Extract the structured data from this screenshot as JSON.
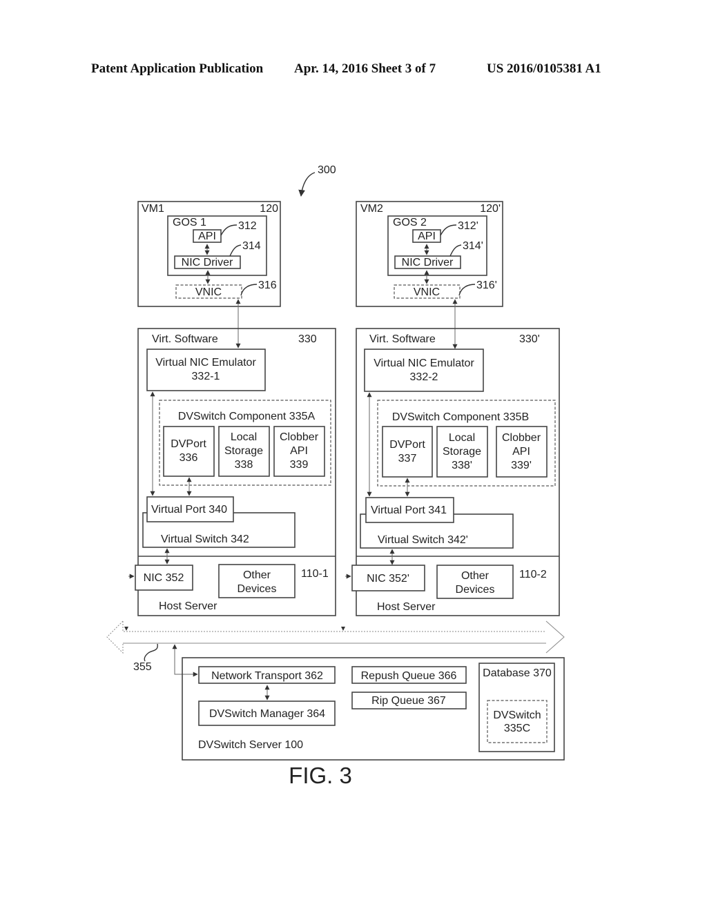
{
  "header": {
    "publication": "Patent Application Publication",
    "date_sheet": "Apr. 14, 2016  Sheet 3 of 7",
    "patent_number": "US 2016/0105381 A1"
  },
  "figure": {
    "ref": "300",
    "caption": "FIG. 3"
  },
  "vm1": {
    "label": "VM1",
    "ref": "120",
    "gos_label": "GOS 1",
    "api_label": "API",
    "api_ref": "312",
    "nic_driver_label": "NIC Driver",
    "nic_driver_ref": "314",
    "vnic_label": "VNIC",
    "vnic_ref": "316"
  },
  "vm2": {
    "label": "VM2",
    "ref": "120'",
    "gos_label": "GOS 2",
    "api_label": "API",
    "api_ref": "312'",
    "nic_driver_label": "NIC Driver",
    "nic_driver_ref": "314'",
    "vnic_label": "VNIC",
    "vnic_ref": "316'"
  },
  "host1": {
    "virt_label": "Virt. Software",
    "virt_ref": "330",
    "emulator_line1": "Virtual NIC Emulator",
    "emulator_line2": "332-1",
    "component_label": "DVSwitch Component 335A",
    "dvport_line1": "DVPort",
    "dvport_line2": "336",
    "storage_line1": "Local",
    "storage_line2": "Storage",
    "storage_line3": "338",
    "clobber_line1": "Clobber",
    "clobber_line2": "API",
    "clobber_line3": "339",
    "vport_label": "Virtual Port 340",
    "vswitch_label": "Virtual Switch 342",
    "nic_label": "NIC 352",
    "other_line1": "Other",
    "other_line2": "Devices",
    "host_ref": "110-1",
    "host_label": "Host Server"
  },
  "host2": {
    "virt_label": "Virt. Software",
    "virt_ref": "330'",
    "emulator_line1": "Virtual NIC Emulator",
    "emulator_line2": "332-2",
    "component_label": "DVSwitch Component 335B",
    "dvport_line1": "DVPort",
    "dvport_line2": "337",
    "storage_line1": "Local",
    "storage_line2": "Storage",
    "storage_line3": "338'",
    "clobber_line1": "Clobber",
    "clobber_line2": "API",
    "clobber_line3": "339'",
    "vport_label": "Virtual Port 341",
    "vswitch_label": "Virtual Switch 342'",
    "nic_label": "NIC 352'",
    "other_line1": "Other",
    "other_line2": "Devices",
    "host_ref": "110-2",
    "host_label": "Host Server"
  },
  "network": {
    "ref": "355"
  },
  "server": {
    "label": "DVSwitch Server 100",
    "transport_label": "Network Transport 362",
    "manager_label": "DVSwitch Manager 364",
    "repush_label": "Repush Queue 366",
    "rip_label": "Rip Queue 367",
    "database_label": "Database 370",
    "dvswitch_line1": "DVSwitch",
    "dvswitch_line2": "335C"
  }
}
